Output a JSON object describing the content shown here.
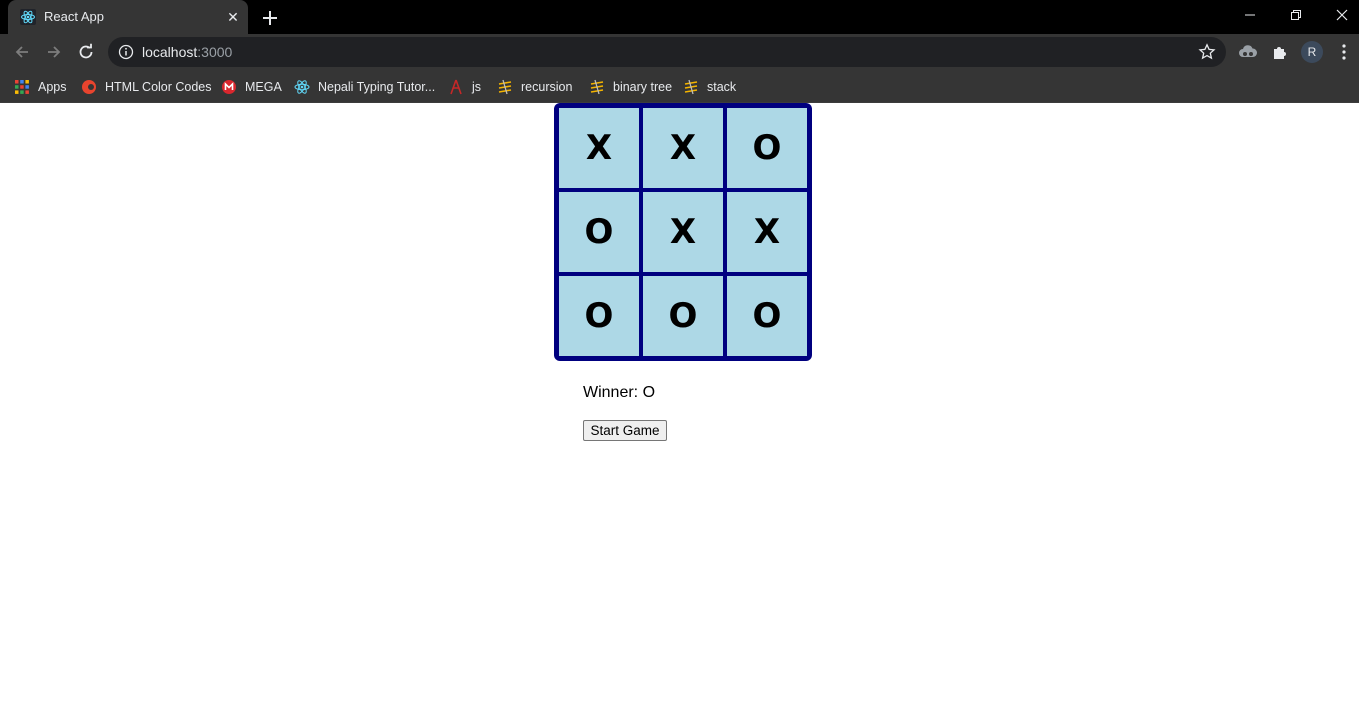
{
  "browser": {
    "tab": {
      "title": "React App",
      "favicon": "react-logo-icon"
    },
    "address": {
      "host": "localhost",
      "port": ":3000"
    },
    "profile_initial": "R",
    "bookmarks": [
      {
        "label": "Apps",
        "icon": "apps-grid-icon"
      },
      {
        "label": "HTML Color Codes",
        "icon": "html-color-codes-icon"
      },
      {
        "label": "MEGA",
        "icon": "mega-icon"
      },
      {
        "label": "Nepali Typing Tutor...",
        "icon": "react-logo-icon"
      },
      {
        "label": "js",
        "icon": "js-icon"
      },
      {
        "label": "recursion",
        "icon": "bookmark-site-icon"
      },
      {
        "label": "binary tree",
        "icon": "bookmark-site-icon"
      },
      {
        "label": "stack",
        "icon": "bookmark-site-icon"
      }
    ]
  },
  "game": {
    "board": [
      "X",
      "X",
      "O",
      "O",
      "X",
      "X",
      "O",
      "O",
      "O"
    ],
    "status": "Winner: O",
    "start_label": "Start Game",
    "colors": {
      "board_border": "#00007f",
      "cell_bg": "#add8e6"
    }
  }
}
